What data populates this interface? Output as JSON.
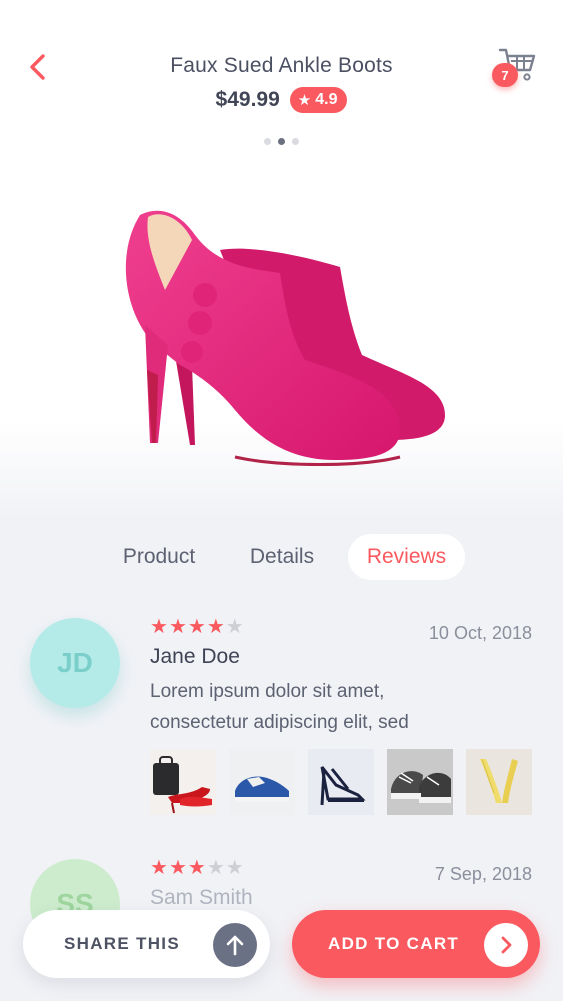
{
  "header": {
    "title": "Faux Sued Ankle Boots",
    "price": "$49.99",
    "rating": "4.9",
    "cart_count": "7"
  },
  "carousel": {
    "total": 3,
    "active": 2
  },
  "tabs": [
    {
      "label": "Product",
      "active": false
    },
    {
      "label": "Details",
      "active": false
    },
    {
      "label": "Reviews",
      "active": true
    }
  ],
  "reviews": [
    {
      "initials": "JD",
      "name": "Jane Doe",
      "date": "10 Oct, 2018",
      "stars": 4,
      "text_line1": "Lorem ipsum dolor sit amet,",
      "text_line2": "consectetur adipiscing elit, sed",
      "avatar_bg": "#b4ebe9",
      "avatar_color": "#7bcfcb",
      "photos": [
        "red-heels-bag-photo",
        "blue-sneakers-photo",
        "strappy-sandal-photo",
        "converse-sneakers-photo",
        "yellow-pumps-photo"
      ]
    },
    {
      "initials": "SS",
      "name": "Sam Smith",
      "date": "7 Sep, 2018",
      "stars": 3,
      "avatar_bg": "#cdeccd",
      "avatar_color": "#9fd69f"
    }
  ],
  "actions": {
    "share_label": "SHARE THIS",
    "cart_label": "ADD TO CART"
  },
  "colors": {
    "accent": "#fa5a5f",
    "text_dark": "#414656",
    "background": "#f1f2f6"
  }
}
